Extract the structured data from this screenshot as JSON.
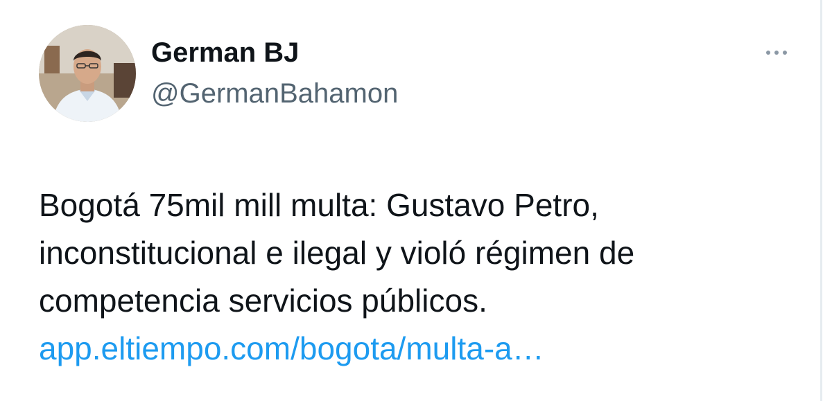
{
  "author": {
    "display_name": "German BJ",
    "handle": "@GermanBahamon",
    "avatar_icon": "profile-photo"
  },
  "more_icon": "more-horizontal-icon",
  "tweet": {
    "lines": [
      "Bogotá 75mil mill multa: Gustavo Petro,",
      "inconstitucional e ilegal y violó régimen de",
      "competencia servicios públicos."
    ],
    "link_text": "app.eltiempo.com/bogota/multa-a…"
  },
  "colors": {
    "text": "#0f1419",
    "secondary": "#536471",
    "link": "#1d9bf0"
  }
}
